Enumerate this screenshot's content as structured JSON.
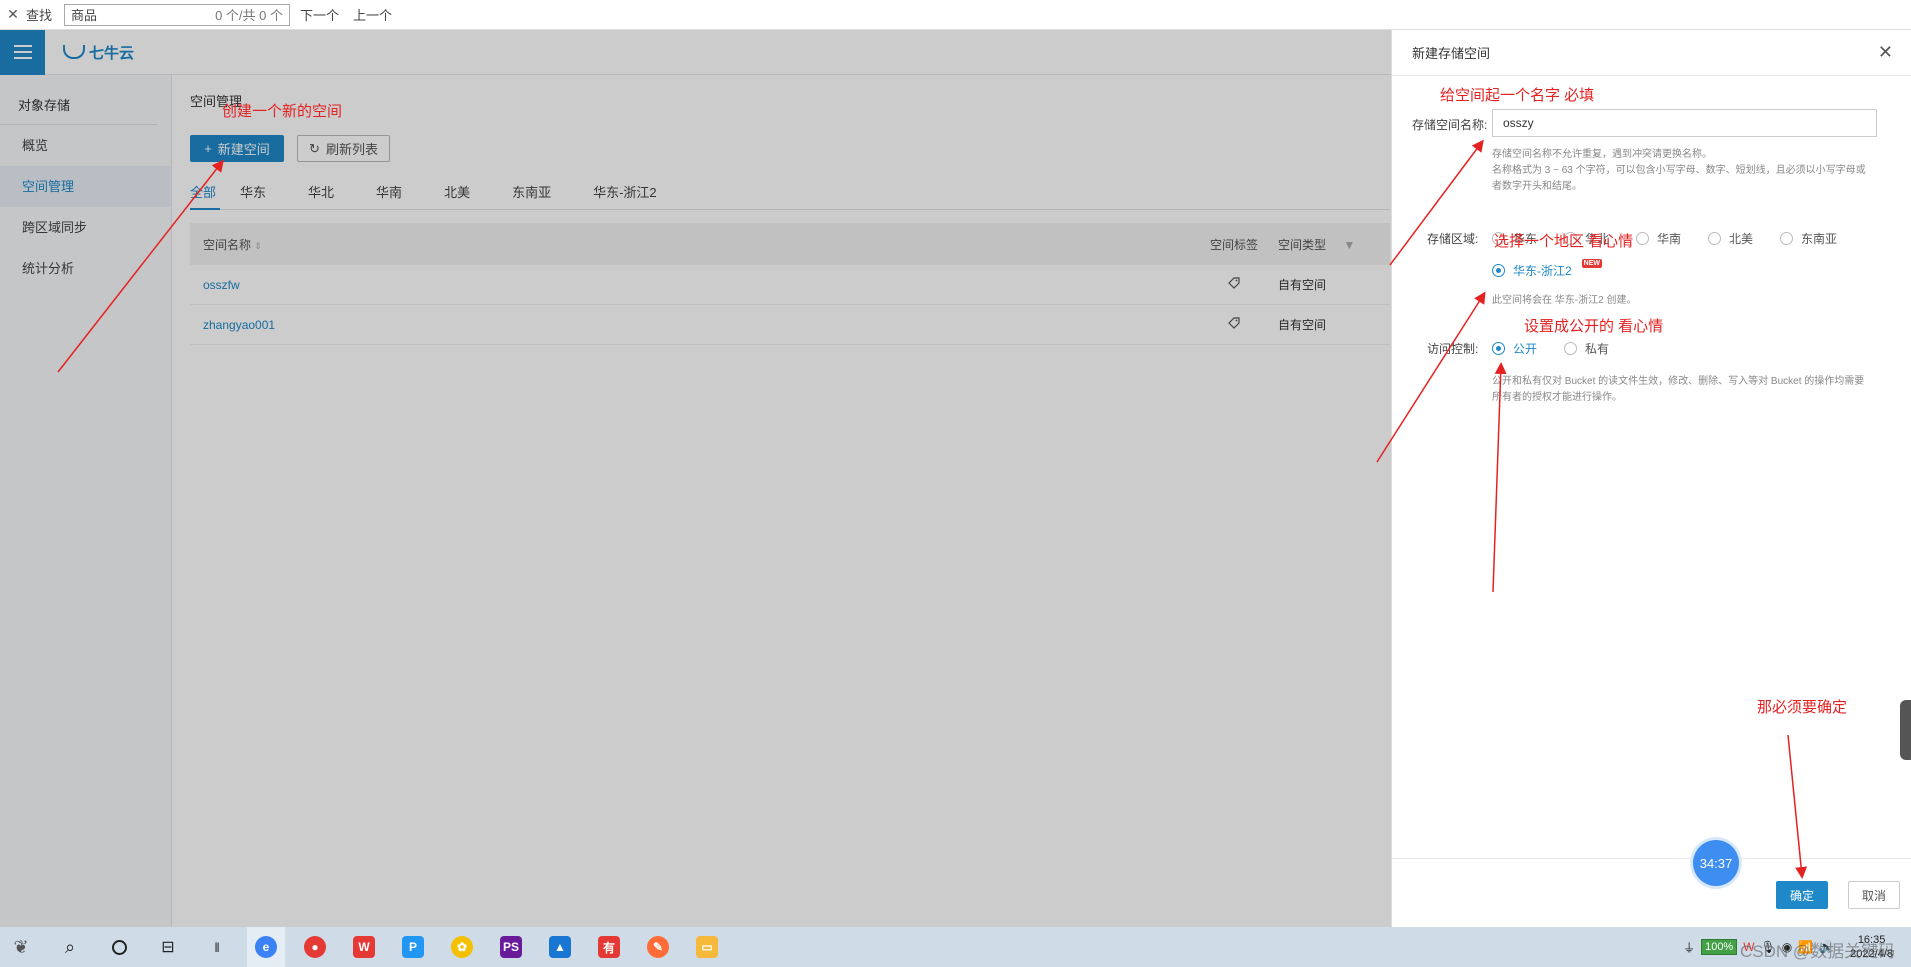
{
  "findbar": {
    "close_glyph": "✕",
    "label": "查找",
    "query": "商品",
    "count": "0 个/共 0 个",
    "next": "下一个",
    "prev": "上一个"
  },
  "app": {
    "logo_text": "七牛云",
    "sidebar": {
      "title": "对象存储",
      "items": [
        {
          "label": "概览"
        },
        {
          "label": "空间管理"
        },
        {
          "label": "跨区域同步"
        },
        {
          "label": "统计分析"
        }
      ]
    },
    "main": {
      "title": "空间管理",
      "new_button": "新建空间",
      "refresh_button": "刷新列表",
      "tabs": [
        "全部",
        "华东",
        "华北",
        "华南",
        "北美",
        "东南亚",
        "华东-浙江2"
      ],
      "table": {
        "headers": {
          "name": "空间名称",
          "tag": "空间标签",
          "type": "空间类型"
        },
        "rows": [
          {
            "name": "osszfw",
            "tag_icon": "tag-icon",
            "type": "自有空间"
          },
          {
            "name": "zhangyao001",
            "tag_icon": "tag-icon",
            "type": "自有空间"
          }
        ]
      }
    }
  },
  "drawer": {
    "title": "新建存储空间",
    "name_label": "存储空间名称:",
    "name_value": "osszy",
    "name_hint": [
      "存储空间名称不允许重复，遇到冲突请更换名称。",
      "名称格式为 3 ~ 63 个字符，可以包含小写字母、数字、短划线，且必须以小写字母或",
      "者数字开头和结尾。"
    ],
    "region_label": "存储区域:",
    "regions": [
      "华东",
      "华北",
      "华南",
      "北美",
      "东南亚",
      "华东-浙江2"
    ],
    "selected_region": "华东-浙江2",
    "new_badge": "NEW",
    "region_hint": "此空间将会在 华东-浙江2 创建。",
    "access_label": "访问控制:",
    "access_options": [
      "公开",
      "私有"
    ],
    "selected_access": "公开",
    "access_hint": [
      "公开和私有仅对 Bucket 的读文件生效，修改、删除、写入等对 Bucket 的操作均需要",
      "所有者的授权才能进行操作。"
    ],
    "ok": "确定",
    "cancel": "取消",
    "timer": "34:37"
  },
  "annotations": {
    "create": "创建一个新的空间",
    "name": "给空间起一个名字 必填",
    "region": "选择一个地区  看心情",
    "access": "设置成公开的  看心情",
    "confirm": "那必须要确定",
    "color": "#e52222"
  },
  "taskbar": {
    "battery": "100%",
    "time": "16:35",
    "date": "2022/4/8",
    "watermark": "CSDN @数据关键码农"
  },
  "colors": {
    "accent": "#1e88c8",
    "taskbar": "#cfdce8"
  }
}
